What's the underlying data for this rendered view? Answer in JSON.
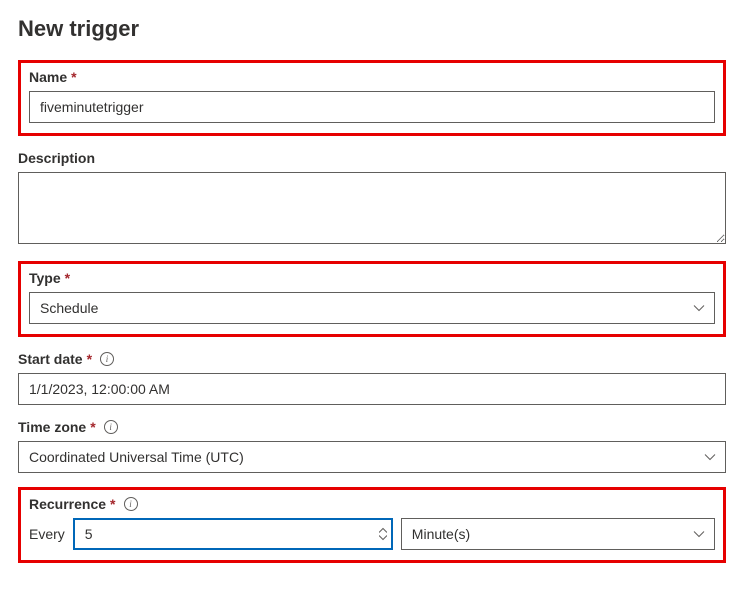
{
  "title": "New trigger",
  "fields": {
    "name": {
      "label": "Name",
      "required": "*",
      "value": "fiveminutetrigger"
    },
    "description": {
      "label": "Description",
      "value": ""
    },
    "type": {
      "label": "Type",
      "required": "*",
      "value": "Schedule"
    },
    "start_date": {
      "label": "Start date",
      "required": "*",
      "value": "1/1/2023, 12:00:00 AM"
    },
    "time_zone": {
      "label": "Time zone",
      "required": "*",
      "value": "Coordinated Universal Time (UTC)"
    },
    "recurrence": {
      "label": "Recurrence",
      "required": "*",
      "every_label": "Every",
      "every_value": "5",
      "unit_value": "Minute(s)"
    }
  }
}
